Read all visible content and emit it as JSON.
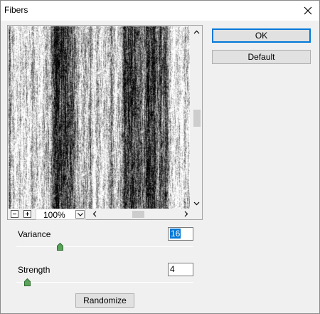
{
  "window": {
    "title": "Fibers"
  },
  "preview": {
    "zoom": "100%"
  },
  "buttons": {
    "ok": "OK",
    "default": "Default",
    "randomize": "Randomize"
  },
  "params": {
    "variance": {
      "label": "Variance",
      "value": "16",
      "min": 1,
      "max": 64
    },
    "strength": {
      "label": "Strength",
      "value": "4",
      "min": 1,
      "max": 64
    }
  },
  "colors": {
    "accent": "#0078d7",
    "thumb": "#5aa35a"
  },
  "icons": {
    "close": "close-icon",
    "zoom_out": "zoom-out-icon",
    "zoom_in": "zoom-in-icon",
    "dropdown": "chevron-down-icon",
    "scroll_up": "chevron-up-icon",
    "scroll_down": "chevron-down-icon",
    "scroll_left": "chevron-left-icon",
    "scroll_right": "chevron-right-icon"
  }
}
